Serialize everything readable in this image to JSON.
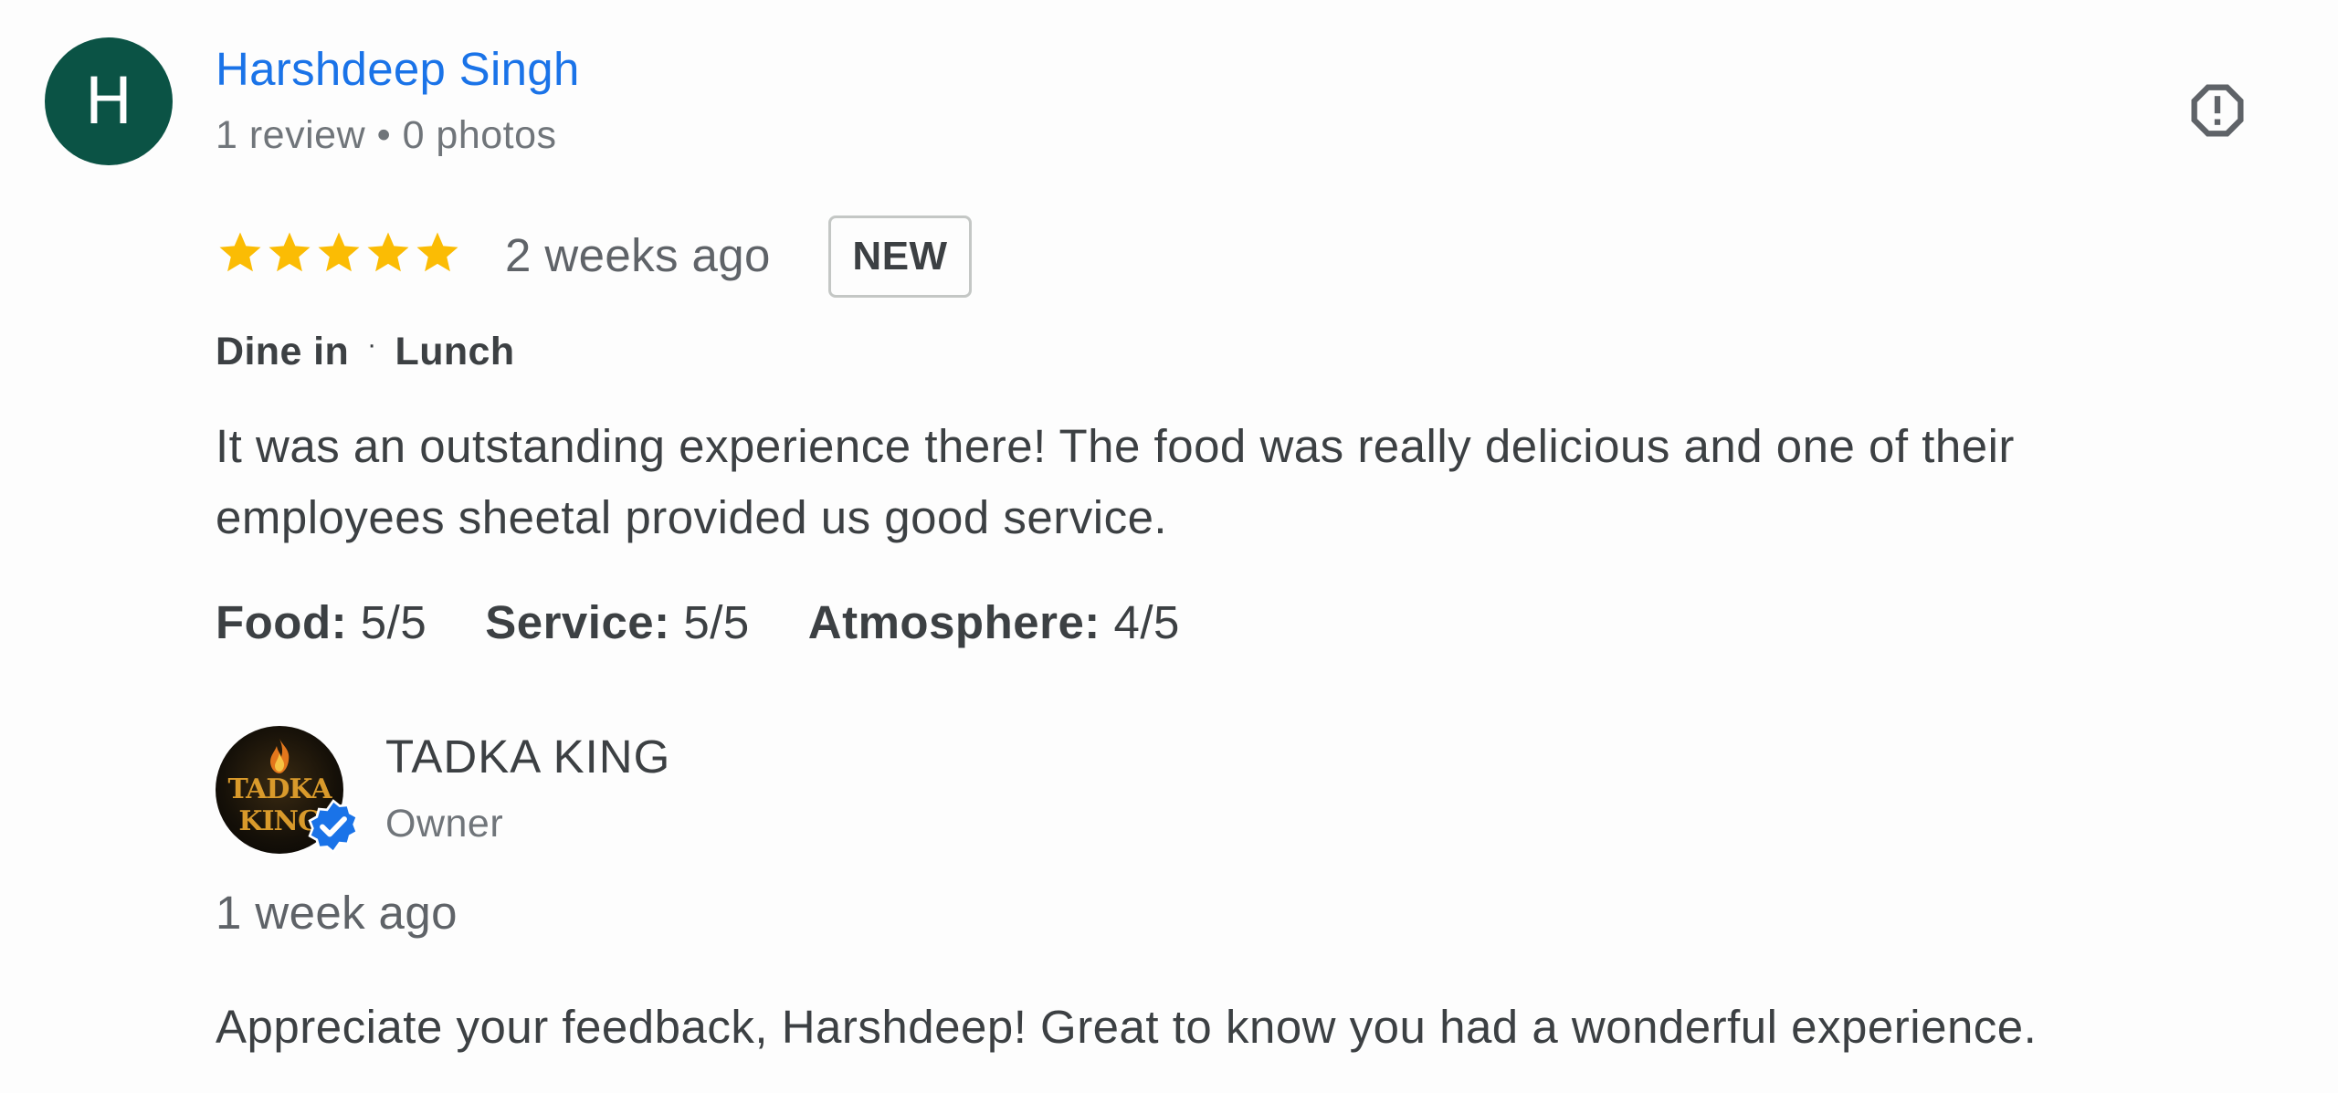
{
  "reviewer": {
    "avatar_letter": "H",
    "avatar_color": "#0b5345",
    "name": "Harshdeep Singh",
    "meta": "1 review • 0 photos"
  },
  "report": {
    "icon": "report-flag-icon"
  },
  "review": {
    "rating": 5,
    "max_rating": 5,
    "star_color": "#fbbc04",
    "date": "2 weeks ago",
    "badge": "NEW",
    "tags": [
      "Dine in",
      "Lunch"
    ],
    "tag_separator": "·",
    "text": "It was an outstanding experience there! The food was really delicious and one of their employees sheetal provided us good service.",
    "ratings": [
      {
        "label": "Food:",
        "value": "5/5"
      },
      {
        "label": "Service:",
        "value": "5/5"
      },
      {
        "label": "Atmosphere:",
        "value": "4/5"
      }
    ]
  },
  "owner_reply": {
    "logo_text": "TADKA KING",
    "name": "TADKA KING",
    "role": "Owner",
    "verified_icon": "verified-badge-icon",
    "verified_color": "#1a73e8",
    "date": "1 week ago",
    "text": "Appreciate your feedback, Harshdeep! Great to know you had a wonderful experience."
  },
  "colors": {
    "link": "#1a73e8",
    "text": "#3c4043",
    "muted": "#70757a"
  }
}
